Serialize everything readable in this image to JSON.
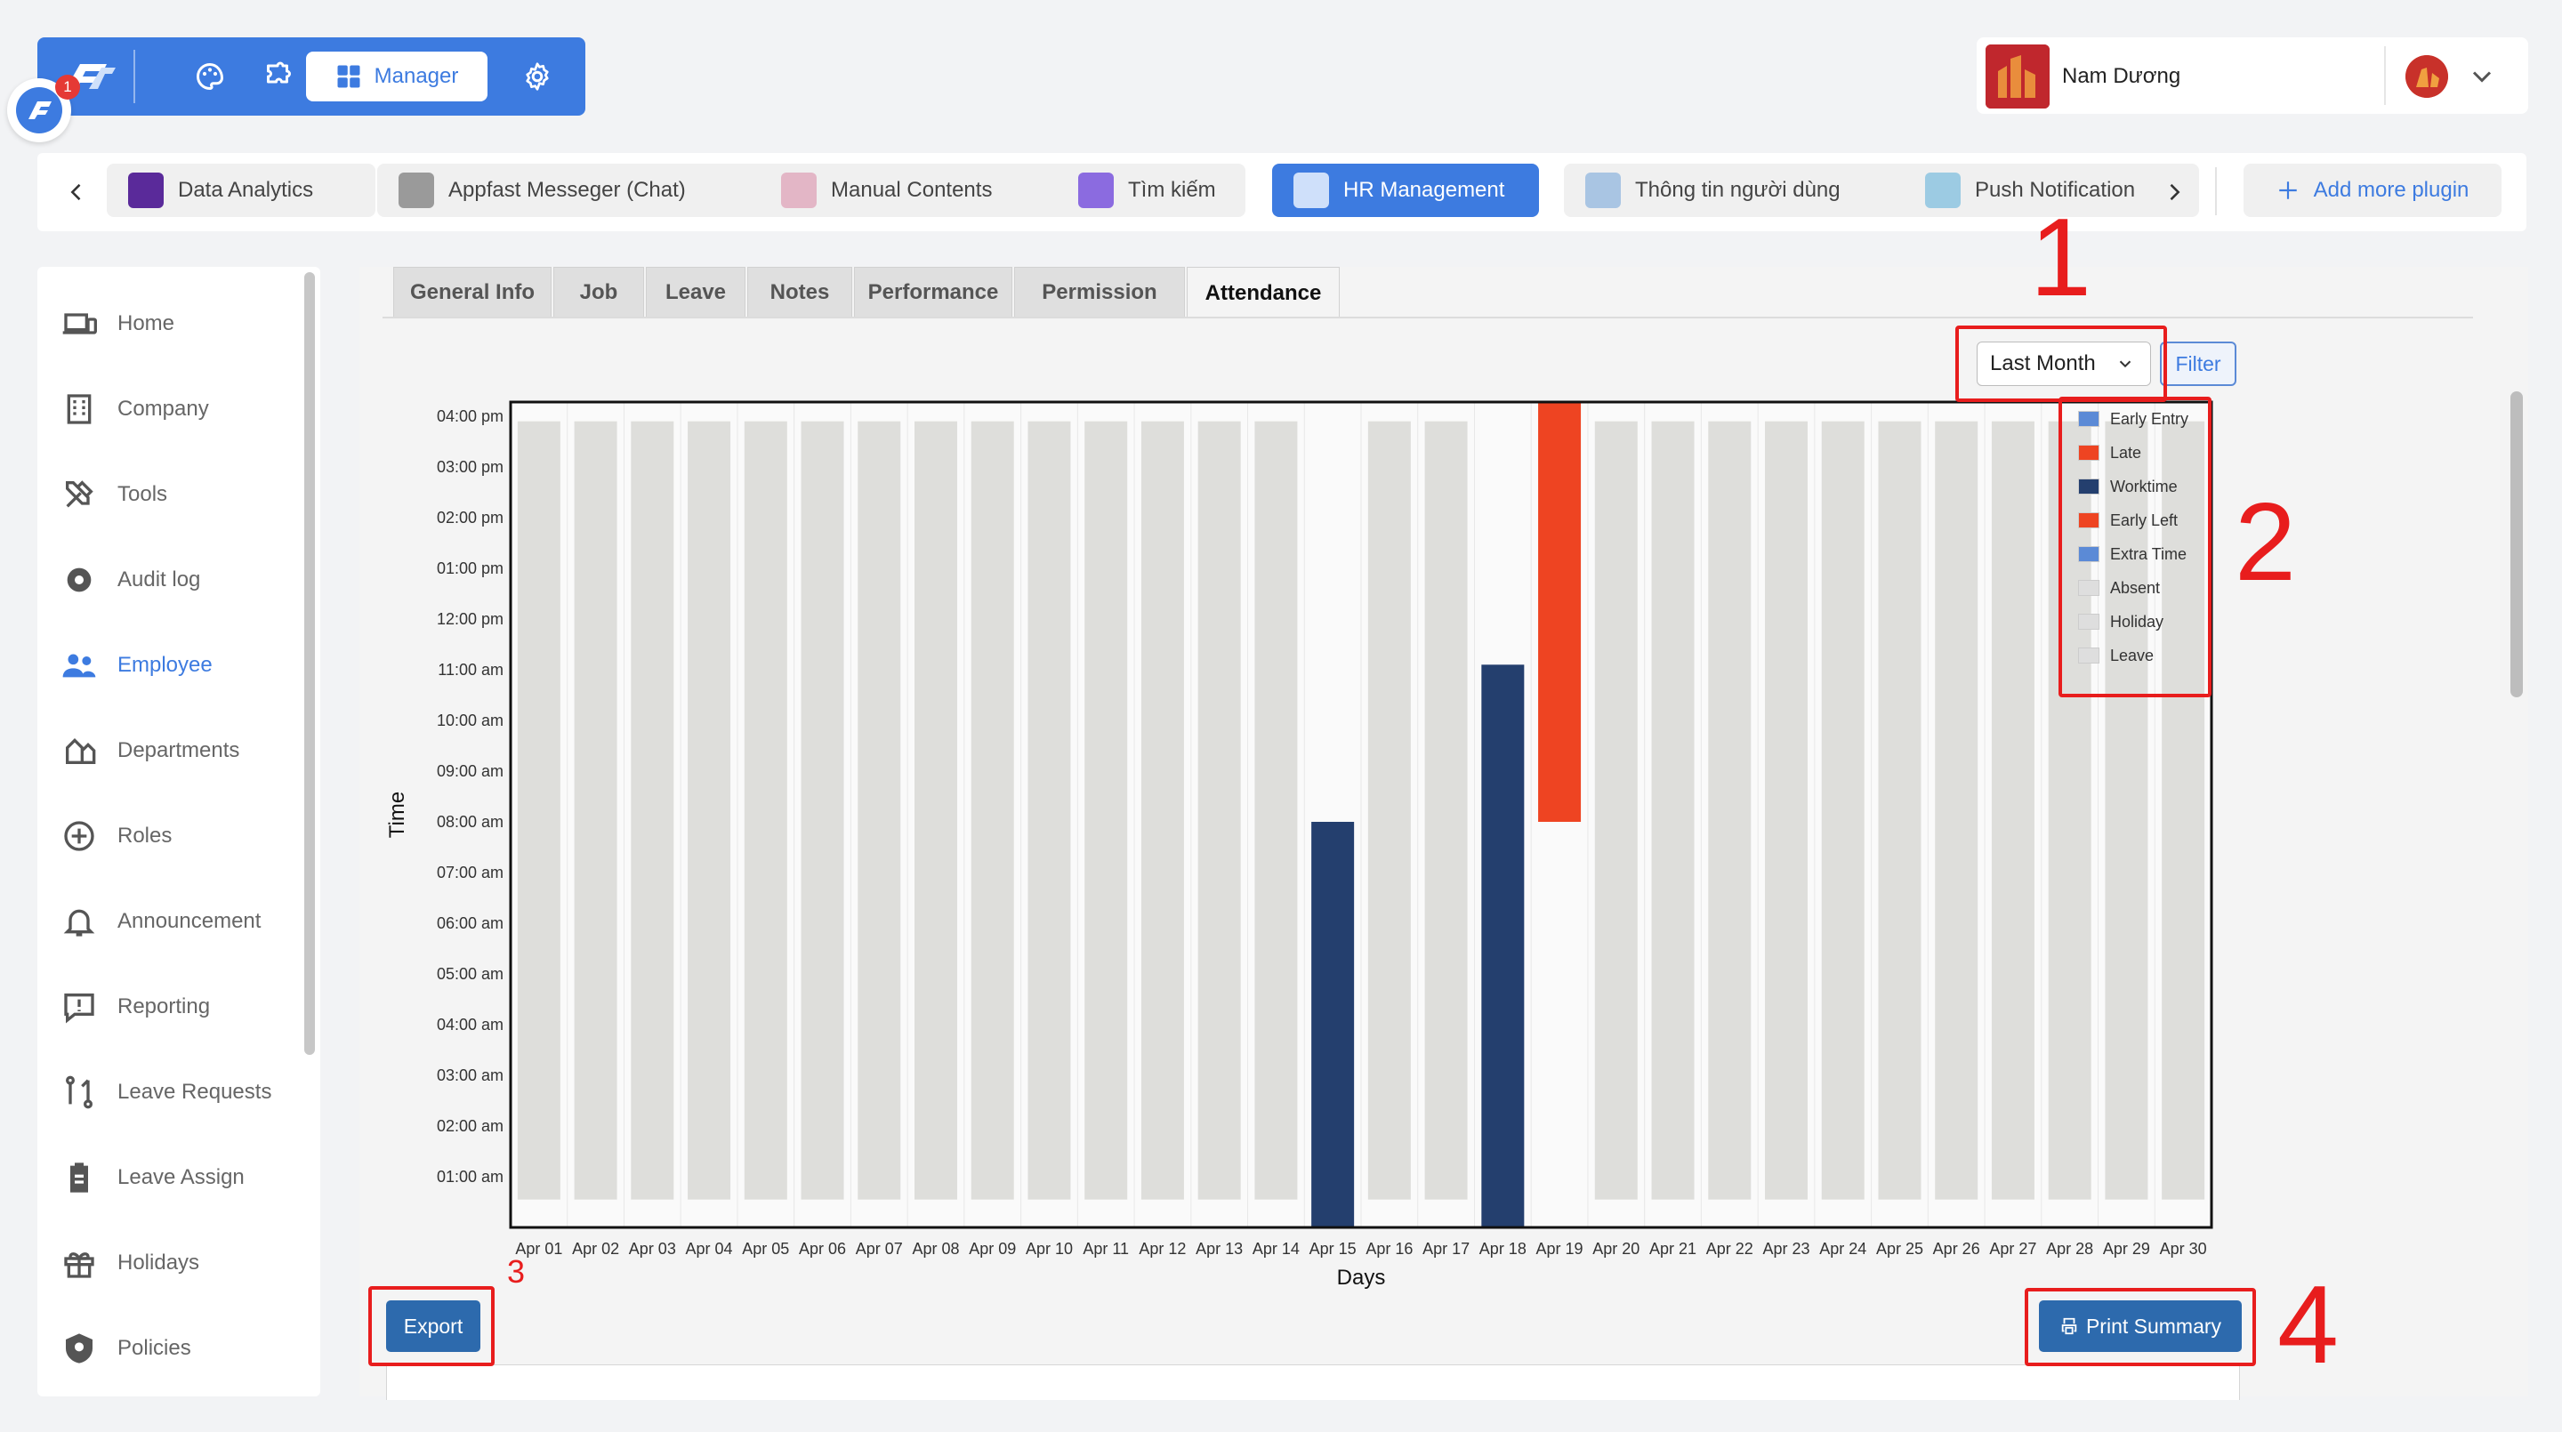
{
  "topbar": {
    "manager_label": "Manager",
    "chat_badge_count": "1",
    "accent": "#3d7be0"
  },
  "user": {
    "name": "Nam Dương"
  },
  "plugins": [
    {
      "label": "Data Analytics",
      "color": "#5a2a9a"
    },
    {
      "label": "Appfast Messeger (Chat)",
      "color": "#8a8a8a"
    },
    {
      "label": "Manual Contents",
      "color": "#d9a3b8"
    },
    {
      "label": "Tìm kiếm",
      "color": "#7a5ad8"
    },
    {
      "label": "HR Management",
      "color": "#ffffff",
      "active": true
    },
    {
      "label": "Thông tin người dùng",
      "color": "#8fb3d6"
    },
    {
      "label": "Push Notification",
      "color": "#7fbcd9"
    }
  ],
  "add_plugin_label": "Add more plugin",
  "sidebar": {
    "items": [
      {
        "label": "Home",
        "icon": "devices-icon"
      },
      {
        "label": "Company",
        "icon": "building-icon"
      },
      {
        "label": "Tools",
        "icon": "tools-icon"
      },
      {
        "label": "Audit log",
        "icon": "gear-icon"
      },
      {
        "label": "Employee",
        "icon": "people-icon",
        "active": true
      },
      {
        "label": "Departments",
        "icon": "org-icon"
      },
      {
        "label": "Roles",
        "icon": "plus-circle-icon"
      },
      {
        "label": "Announcement",
        "icon": "bell-icon"
      },
      {
        "label": "Reporting",
        "icon": "report-icon"
      },
      {
        "label": "Leave Requests",
        "icon": "flow-icon"
      },
      {
        "label": "Leave Assign",
        "icon": "clipboard-icon"
      },
      {
        "label": "Holidays",
        "icon": "gift-icon"
      },
      {
        "label": "Policies",
        "icon": "shield-icon"
      }
    ]
  },
  "subtabs": [
    "General Info",
    "Job",
    "Leave",
    "Notes",
    "Performance",
    "Permission",
    "Attendance"
  ],
  "active_subtab": "Attendance",
  "period": {
    "selected": "Last Month"
  },
  "filter_label": "Filter",
  "export_label": "Export",
  "print_label": "Print Summary",
  "annotations": [
    "1",
    "2",
    "3",
    "4"
  ],
  "chart_data": {
    "type": "bar",
    "xlabel": "Days",
    "ylabel": "Time",
    "categories": [
      "Apr 01",
      "Apr 02",
      "Apr 03",
      "Apr 04",
      "Apr 05",
      "Apr 06",
      "Apr 07",
      "Apr 08",
      "Apr 09",
      "Apr 10",
      "Apr 11",
      "Apr 12",
      "Apr 13",
      "Apr 14",
      "Apr 15",
      "Apr 16",
      "Apr 17",
      "Apr 18",
      "Apr 19",
      "Apr 20",
      "Apr 21",
      "Apr 22",
      "Apr 23",
      "Apr 24",
      "Apr 25",
      "Apr 26",
      "Apr 27",
      "Apr 28",
      "Apr 29",
      "Apr 30"
    ],
    "y_ticks": [
      "01:00 am",
      "02:00 am",
      "03:00 am",
      "04:00 am",
      "05:00 am",
      "06:00 am",
      "07:00 am",
      "08:00 am",
      "09:00 am",
      "10:00 am",
      "11:00 am",
      "12:00 pm",
      "01:00 pm",
      "02:00 pm",
      "03:00 pm",
      "04:00 pm"
    ],
    "ylim_hours": [
      0.0,
      16.45
    ],
    "legend_position": "top-right",
    "series": [
      {
        "name": "Early Entry",
        "color": "#5b8ad6",
        "bars": []
      },
      {
        "name": "Late",
        "color": "#ee4422",
        "bars": [
          {
            "day": "Apr 19",
            "from_hour": 8.0,
            "to_hour": 16.45
          }
        ]
      },
      {
        "name": "Worktime",
        "color": "#243f6e",
        "bars": [
          {
            "day": "Apr 15",
            "from_hour": 0.0,
            "to_hour": 8.0
          },
          {
            "day": "Apr 18",
            "from_hour": 0.0,
            "to_hour": 11.1
          }
        ]
      },
      {
        "name": "Early Left",
        "color": "#ee4422",
        "bars": []
      },
      {
        "name": "Extra Time",
        "color": "#5b8ad6",
        "bars": []
      },
      {
        "name": "Absent",
        "color": "#dedede",
        "bars": []
      },
      {
        "name": "Holiday",
        "color": "#dedede",
        "bars": []
      },
      {
        "name": "Leave",
        "color": "#dedede",
        "bars": []
      }
    ],
    "absent_days": [
      "Apr 01",
      "Apr 02",
      "Apr 03",
      "Apr 04",
      "Apr 05",
      "Apr 06",
      "Apr 07",
      "Apr 08",
      "Apr 09",
      "Apr 10",
      "Apr 11",
      "Apr 12",
      "Apr 13",
      "Apr 14",
      "Apr 16",
      "Apr 17",
      "Apr 20",
      "Apr 21",
      "Apr 22",
      "Apr 23",
      "Apr 24",
      "Apr 25",
      "Apr 26",
      "Apr 27",
      "Apr 28",
      "Apr 29",
      "Apr 30"
    ],
    "absent_range_hours": [
      0.55,
      15.9
    ],
    "grid": true
  }
}
